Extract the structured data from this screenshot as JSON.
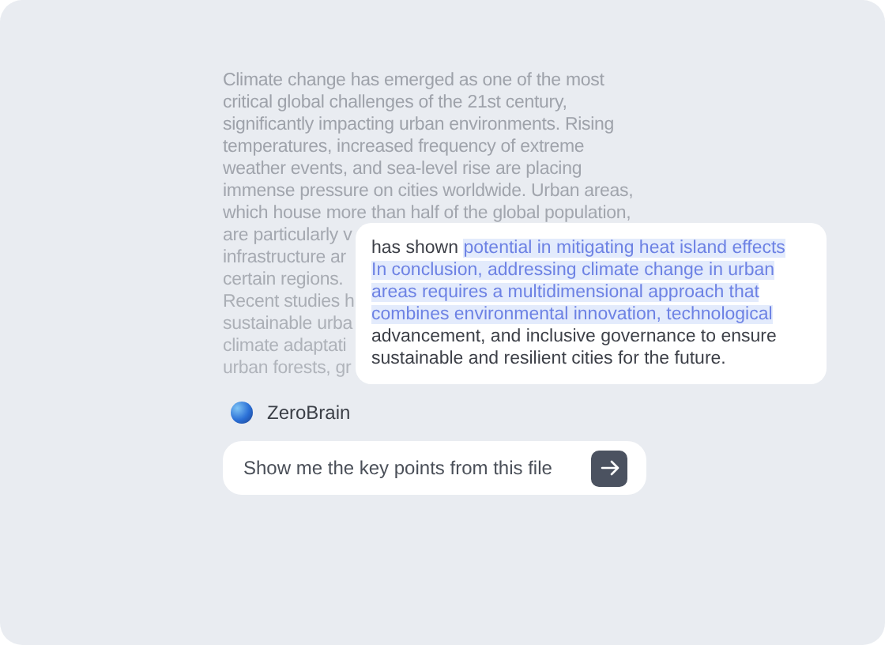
{
  "document": {
    "lines": [
      "Climate change has emerged as one of the most",
      "critical global challenges of the 21st century,",
      "significantly impacting urban environments. Rising",
      "temperatures, increased frequency of extreme",
      "weather events, and sea-level rise are placing",
      "immense pressure on cities worldwide. Urban areas,",
      "which house more than half of the global population,",
      "are particularly v",
      "infrastructure ar",
      "certain regions.",
      "Recent studies h",
      "sustainable urba",
      "climate adaptati",
      "urban forests, gr"
    ]
  },
  "response": {
    "lines": [
      [
        {
          "text": "has shown ",
          "highlighted": false
        },
        {
          "text": "potential in mitigating heat island effects",
          "highlighted": true
        }
      ],
      [
        {
          "text": "In conclusion, addressing climate change in urban",
          "highlighted": true
        }
      ],
      [
        {
          "text": "areas requires a multidimensional approach that",
          "highlighted": true
        }
      ],
      [
        {
          "text": "combines environmental innovation, technological",
          "highlighted": true
        }
      ],
      [
        {
          "text": "advancement, and inclusive governance to ensure",
          "highlighted": false
        }
      ],
      [
        {
          "text": "sustainable and resilient cities for the future.",
          "highlighted": false
        }
      ]
    ]
  },
  "assistant": {
    "name": "ZeroBrain"
  },
  "prompt": {
    "value": "Show me the key points from this file"
  }
}
